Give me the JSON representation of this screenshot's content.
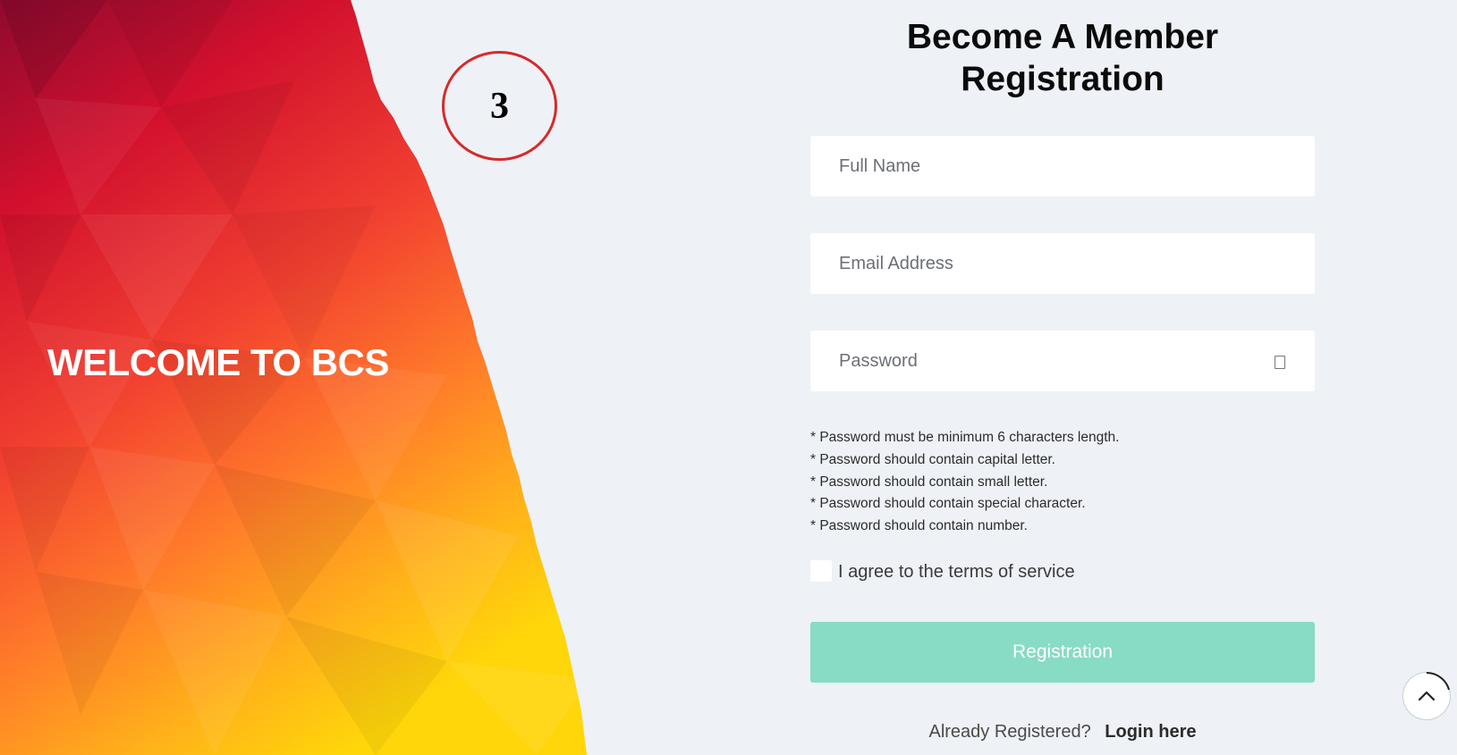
{
  "hero": {
    "welcome_text": "WELCOME TO BCS",
    "gradient_colors": [
      "#8f0a2f",
      "#d2102e",
      "#f24130",
      "#ff7a2a",
      "#ffb21a",
      "#ffd60a"
    ]
  },
  "annotation": {
    "step_number": "3"
  },
  "form": {
    "title_line1": "Become A Member",
    "title_line2": "Registration",
    "full_name_placeholder": "Full Name",
    "email_placeholder": "Email Address",
    "password_placeholder": "Password",
    "password_rules": [
      "* Password must be minimum 6 characters length.",
      "* Password should contain capital letter.",
      "* Password should contain small letter.",
      "* Password should contain special character.",
      "* Password should contain number."
    ],
    "agree_label": "I agree to the terms of service",
    "submit_label": "Registration",
    "submit_color": "#88dbc4",
    "already_text": "Already Registered?",
    "login_link": "Login here"
  },
  "icons": {
    "password_toggle": "eye-icon",
    "scroll_top": "chevron-up-icon"
  }
}
